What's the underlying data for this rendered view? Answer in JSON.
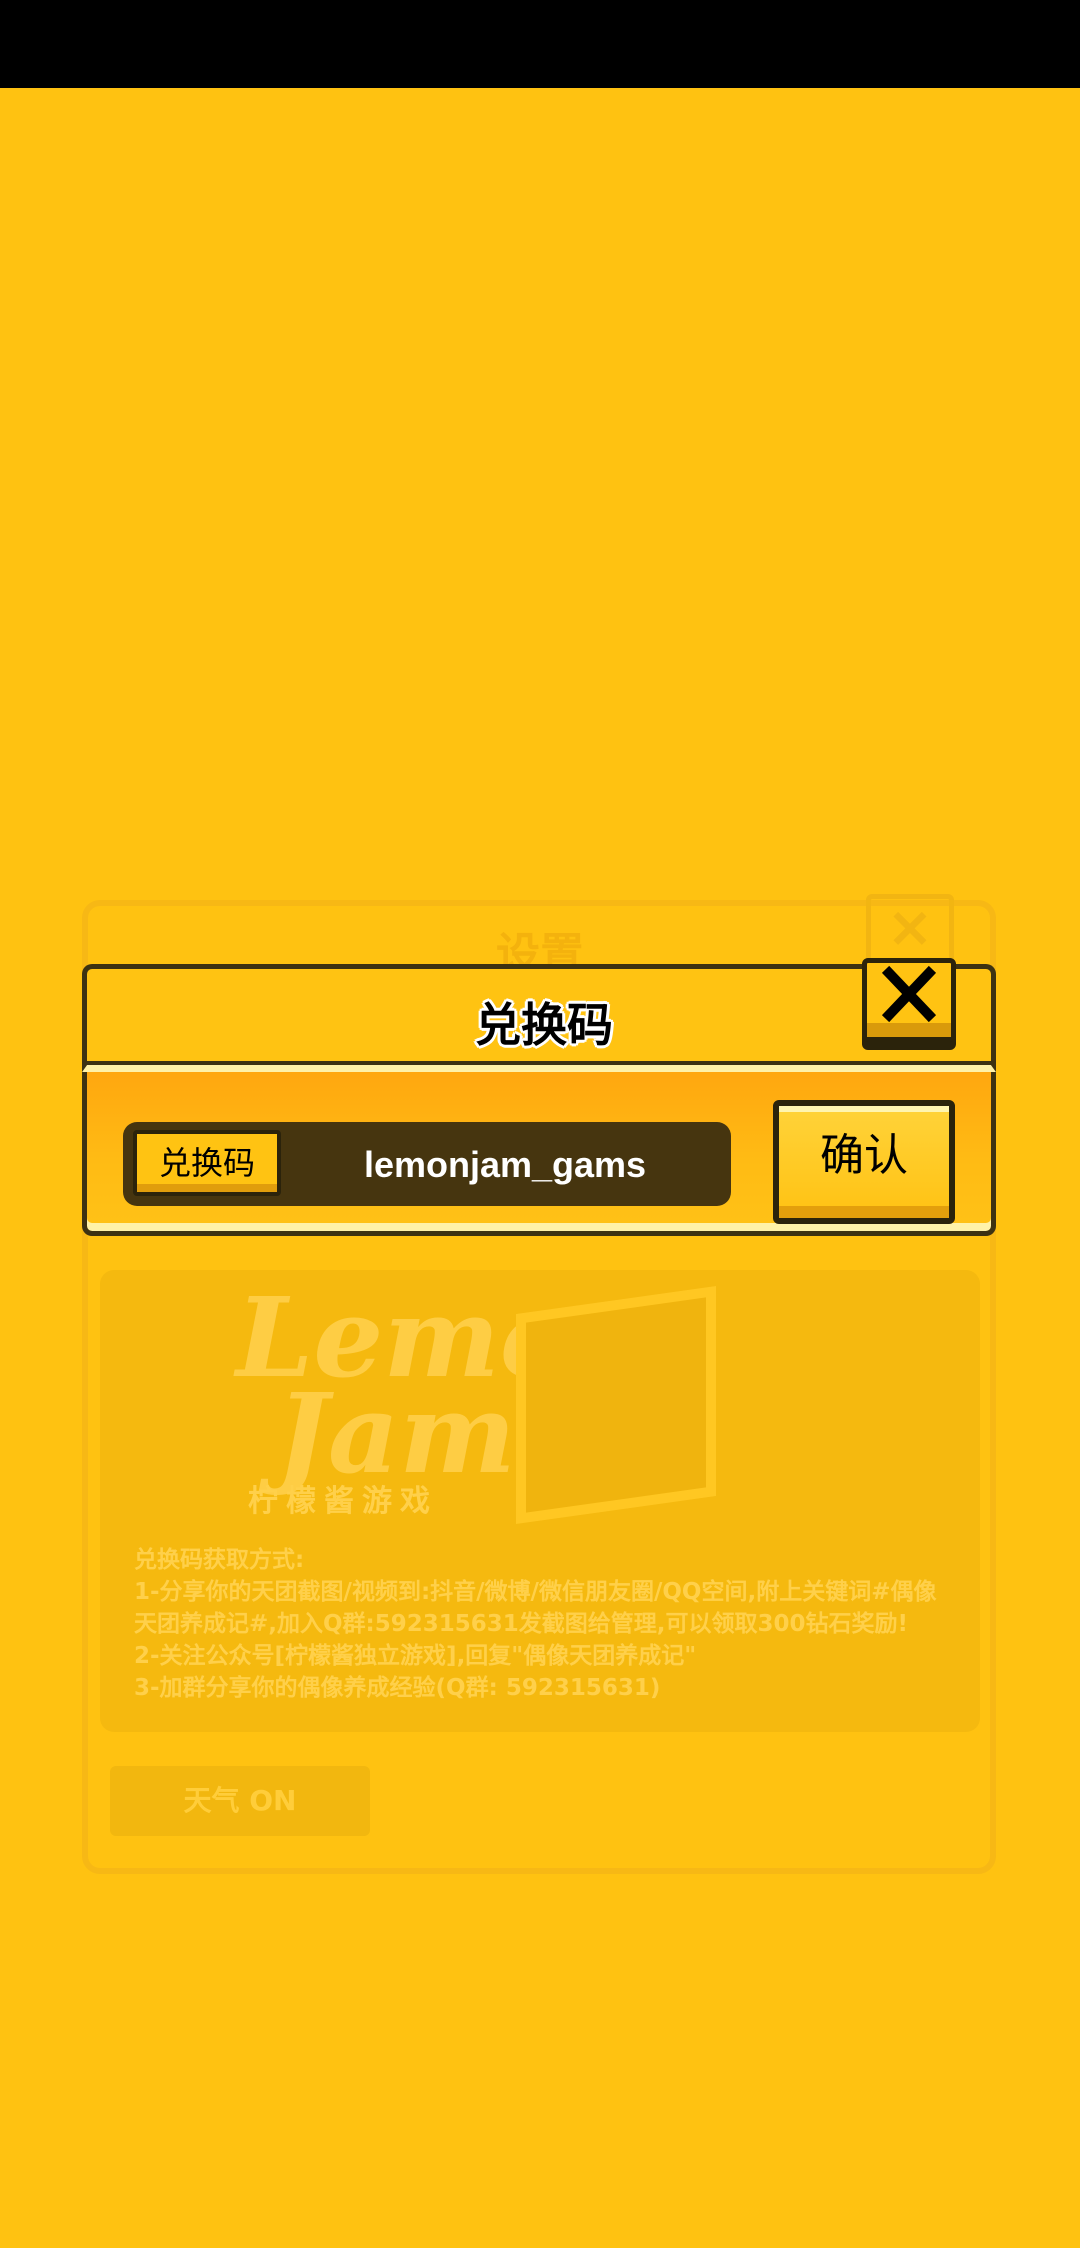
{
  "background_panel": {
    "title": "设置",
    "description_lines": [
      "兑换码获取方式:",
      "1-分享你的天团截图/视频到:抖音/微博/微信朋友圈/QQ空间,附上关键词#偶像",
      "天团养成记#,加入Q群:592315631发截图给管理,可以领取300钻石奖励!",
      "2-关注公众号[柠檬酱独立游戏],回复\"偶像天团养成记\"",
      "3-加群分享你的偶像养成经验(Q群: 592315631)"
    ],
    "logo_text_line1": "Lemon",
    "logo_text_line2": "Jam",
    "logo_subtitle": "柠檬酱游戏",
    "weather_button": "天气 ON"
  },
  "dialog": {
    "title": "兑换码",
    "code_label": "兑换码",
    "code_value": "lemonjam_gams",
    "confirm_label": "确认"
  },
  "colors": {
    "background": "#ffc211",
    "dialog_body": "#ffa70f",
    "field_dark": "#46350f",
    "outline": "#2b230b"
  }
}
